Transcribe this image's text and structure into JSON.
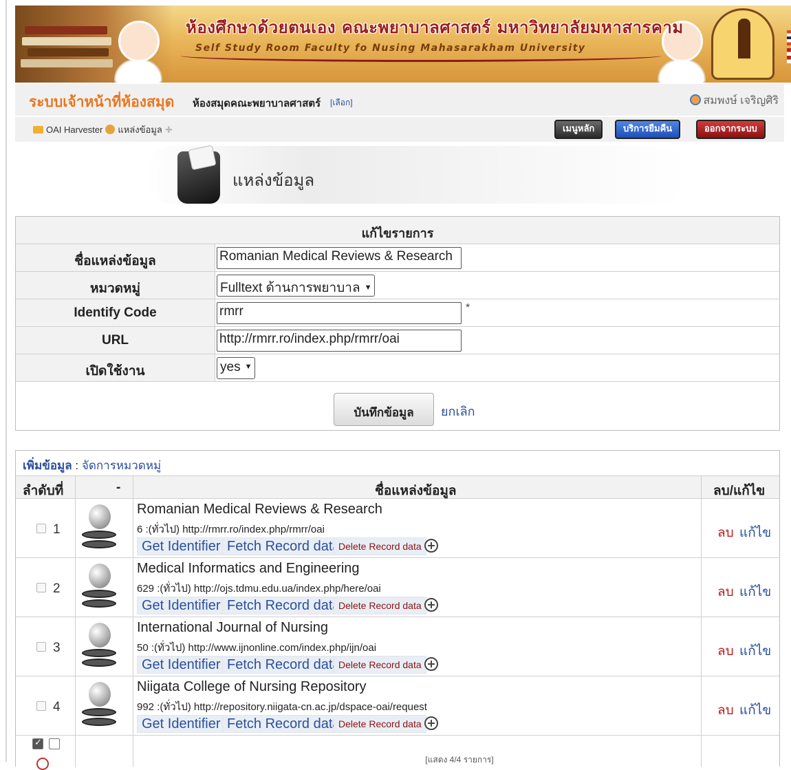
{
  "banner": {
    "title_th": "ห้องศึกษาด้วยตนเอง คณะพยาบาลศาสตร์ มหาวิทยาลัยมหาสารคาม",
    "title_en": "Self Study Room Faculty fo Nusing Mahasarakham University"
  },
  "header": {
    "system_title": "ระบบเจ้าหน้าที่ห้องสมุด",
    "library_name": "ห้องสมุดคณะพยาบาลศาสตร์",
    "select_link": "[เลือก]",
    "user_name": "สมพงษ์ เจริญศิริ"
  },
  "breadcrumb": {
    "root": "OAI Harvester",
    "current": "แหล่งข้อมูล"
  },
  "top_buttons": {
    "main_menu": "เมนูหลัก",
    "loan_service": "บริการยืมคืน",
    "logout": "ออกจากระบบ"
  },
  "page_title": "แหล่งข้อมูล",
  "edit_form": {
    "heading": "แก้ไขรายการ",
    "name_label": "ชื่อแหล่งข้อมูล",
    "name_value": "Romanian Medical Reviews & Research",
    "category_label": "หมวดหมู่",
    "category_value": "Fulltext ด้านการพยาบาล",
    "identify_label": "Identify Code",
    "identify_value": "rmrr",
    "required_mark": "*",
    "url_label": "URL",
    "url_value": "http://rmrr.ro/index.php/rmrr/oai",
    "enabled_label": "เปิดใช้งาน",
    "enabled_value": "yes",
    "save_label": "บันทึกข้อมูล",
    "cancel_label": "ยกเลิก"
  },
  "list": {
    "add_label": "เพิ่มข้อมูล",
    "separator": " : ",
    "manage_category": "จัดการหมวดหมู่",
    "col_order": "ลำดับที่",
    "col_icon": "-",
    "col_name": "ชื่อแหล่งข้อมูล",
    "col_actions": "ลบ/แก้ไข",
    "btn_get_identifier": "Get Identifier",
    "btn_fetch_record": "Fetch Record data",
    "btn_delete_record": "Delete Record data",
    "lbl_delete": "ลบ",
    "lbl_edit": "แก้ไข",
    "summary": "[แสดง 4/4 รายการ]",
    "rows": [
      {
        "no": "1",
        "name": "Romanian Medical Reviews & Research",
        "meta": "6 :(ทั่วไป) http://rmrr.ro/index.php/rmrr/oai"
      },
      {
        "no": "2",
        "name": "Medical Informatics and Engineering",
        "meta": "629 :(ทั่วไป) http://ojs.tdmu.edu.ua/index.php/here/oai"
      },
      {
        "no": "3",
        "name": "International Journal of Nursing",
        "meta": "50 :(ทั่วไป) http://www.ijnonline.com/index.php/ijn/oai"
      },
      {
        "no": "4",
        "name": "Niigata College of Nursing Repository",
        "meta": "992 :(ทั่วไป) http://repository.niigata-cn.ac.jp/dspace-oai/request"
      }
    ]
  }
}
